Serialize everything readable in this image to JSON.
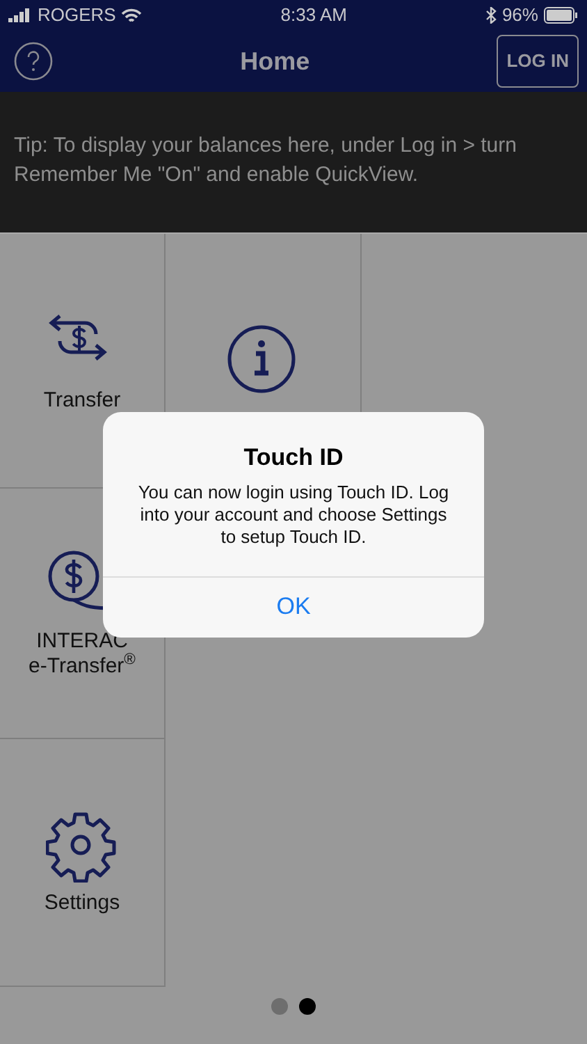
{
  "status_bar": {
    "carrier": "ROGERS",
    "time": "8:33 AM",
    "battery": "96%"
  },
  "nav": {
    "title": "Home",
    "login_button": "LOG IN"
  },
  "tip": "Tip: To display your balances here, under Log in > turn Remember Me \"On\" and enable QuickView.",
  "tiles": [
    {
      "kind": "transfer",
      "lines": [
        "Transfer"
      ]
    },
    {
      "kind": "info"
    },
    {
      "kind": "etransfer",
      "lines": [
        "INTERAC",
        "e-Transfer$^{®}$"
      ]
    },
    {
      "kind": "settings",
      "lines": [
        "Settings"
      ]
    }
  ],
  "dialog": {
    "title": "Touch ID",
    "message": "You can now login using Touch ID. Log into your account and choose Settings to setup Touch ID.",
    "button": "OK"
  },
  "page_dots": [
    {
      "selected": false
    },
    {
      "selected": true
    }
  ]
}
